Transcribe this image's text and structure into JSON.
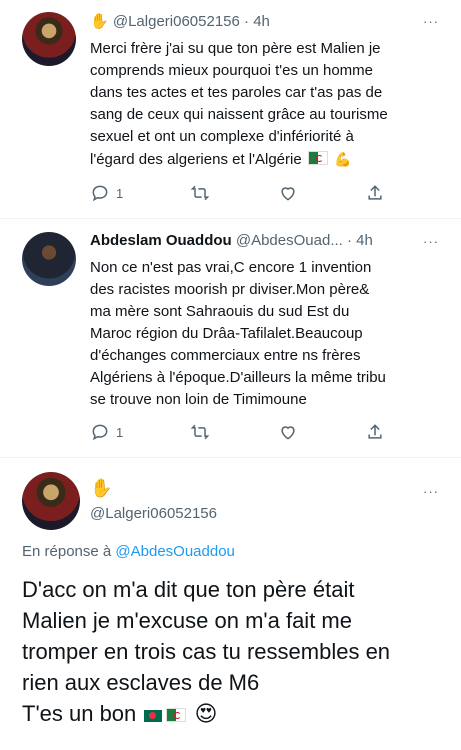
{
  "tweet1": {
    "emoji": "✋",
    "handle": "@Lalgeri06052156",
    "time": "· 4h",
    "more": "···",
    "text": "Merci frère j'ai su que ton père est Malien je\ncomprends mieux pourquoi t'es un homme\ndans tes actes et tes paroles car t'as pas de\nsang de ceux qui naissent grâce au tourisme\nsexuel et ont un complexe d'infériorité à\nl'égard des algeriens et l'Algérie",
    "trail_emoji": "💪",
    "reply_count": "1"
  },
  "tweet2": {
    "name": "Abdeslam Ouaddou",
    "handle": "@AbdesOuad...",
    "time": "· 4h",
    "more": "···",
    "text": "Non ce n'est pas vrai,C encore 1 invention\ndes racistes moorish pr diviser.Mon père&\nma mère sont Sahraouis du sud Est du\nMaroc région du Drâa-Tafilalet.Beaucoup\n d'échanges commerciaux entre ns frères\nAlgériens à l'époque.D'ailleurs la même tribu\nse trouve non loin de  Timimoune",
    "reply_count": "1"
  },
  "tweet3": {
    "emoji": "✋",
    "handle": "@Lalgeri06052156",
    "more": "···",
    "reply_prefix": "En réponse à ",
    "reply_to": "@AbdesOuaddou",
    "text": "D'acc on m'a dit que ton père était\nMalien je m'excuse on m'a fait me\ntromper en trois cas tu ressembles en\nrien aux esclaves de M6\nT'es un bon",
    "trail_emoji": "😍"
  },
  "icons": [
    "reply-icon",
    "retweet-icon",
    "like-icon",
    "share-icon"
  ]
}
